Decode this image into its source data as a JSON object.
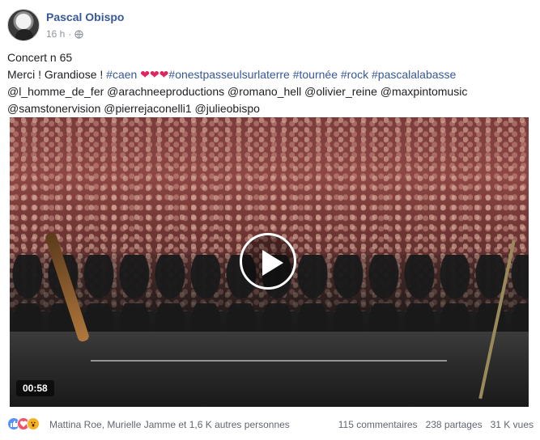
{
  "post": {
    "author": "Pascal Obispo",
    "time": "16 h",
    "separator": "·",
    "line1": "Concert n 65",
    "line2_prefix": "Merci ! Grandiose ! ",
    "tags_line2": [
      "#caen",
      "#onestpasseulsurlaterre",
      "#tournée",
      "#rock",
      "#pascalalabasse"
    ],
    "line3": "@l_homme_de_fer @arachneeproductions @romano_hell @olivier_reine @maxpintomusic",
    "line4": "@samstonervision @pierrejaconelli1 @julieobispo"
  },
  "video": {
    "duration": "00:58"
  },
  "footer": {
    "reactors": "Mattina Roe, Murielle Jamme et 1,6 K autres personnes",
    "comments": "115 commentaires",
    "shares": "238 partages",
    "views": "31 K vues"
  },
  "icons": {
    "like": "like-reaction-icon",
    "love": "love-reaction-icon",
    "wow": "wow-reaction-icon",
    "globe": "globe-icon",
    "play": "play-icon"
  },
  "colors": {
    "link": "#365899",
    "author": "#385898",
    "heart": "#e0245e"
  }
}
